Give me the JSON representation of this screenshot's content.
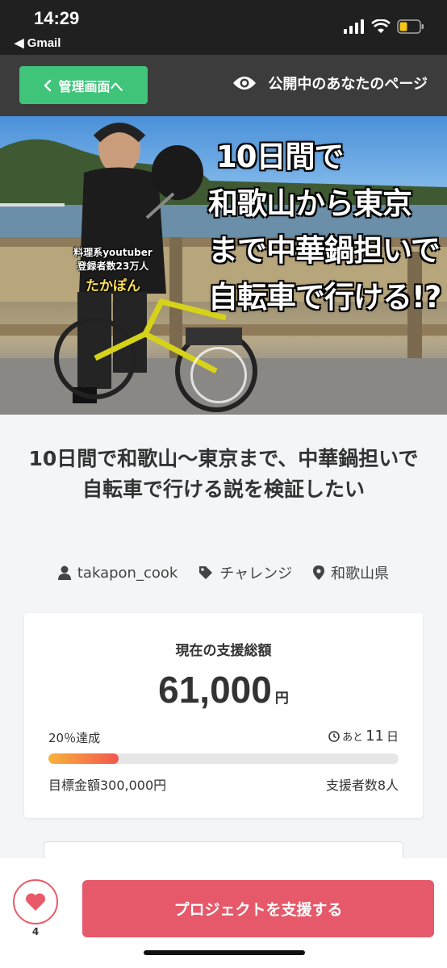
{
  "status_bar": {
    "time": "14:29",
    "back_app": "◀ Gmail"
  },
  "nav": {
    "admin_button": "管理画面へ",
    "public_page_link": "公開中のあなたのページ"
  },
  "hero": {
    "headline_lines": [
      "10日間で",
      "和歌山から東京",
      "まで中華鍋担いで",
      "自転車で行ける!?"
    ],
    "caption_lines": [
      "料理系youtuber",
      "登録者数23万人",
      "たかぽん"
    ]
  },
  "project": {
    "title": "10日間で和歌山〜東京まで、中華鍋担いで自転車で行ける説を検証したい",
    "owner": "takapon_cook",
    "category": "チャレンジ",
    "location": "和歌山県"
  },
  "funding": {
    "label": "現在の支援総額",
    "amount": "61,000",
    "currency": "円",
    "achievement": "20％達成",
    "progress_fraction": 0.2,
    "remaining_prefix": "あと",
    "remaining_days": "11",
    "remaining_unit": "日",
    "goal": "目標金額300,000円",
    "supporters": "支援者数8人"
  },
  "bottom": {
    "favorite_count": "4",
    "support_button": "プロジェクトを支援する"
  },
  "colors": {
    "accent_green": "#3fc47a",
    "accent_red": "#e5596a",
    "progress_start": "#f7b23b",
    "progress_end": "#f4564f"
  }
}
